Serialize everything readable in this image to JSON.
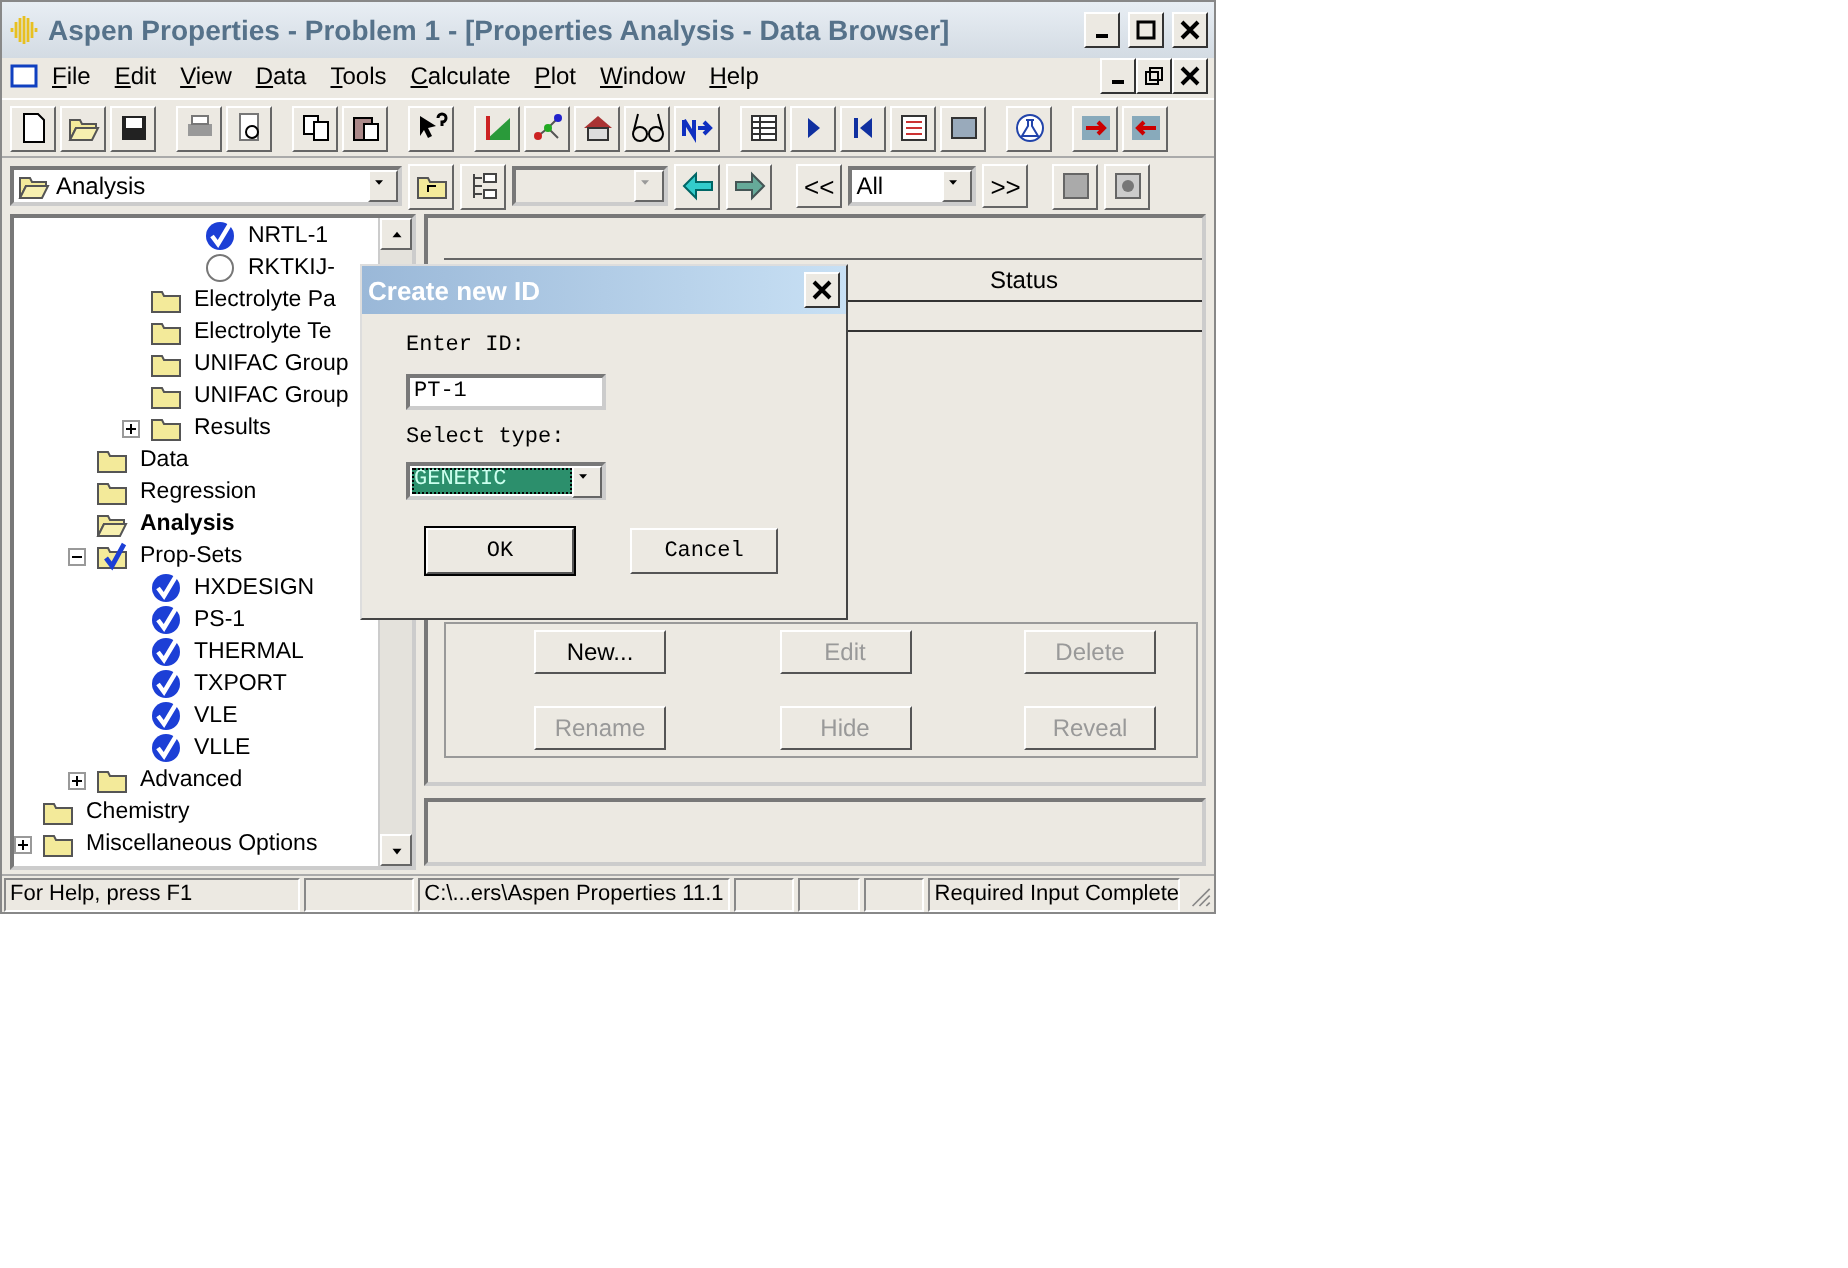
{
  "window": {
    "title": "Aspen Properties - Problem 1 - [Properties Analysis - Data Browser]"
  },
  "menu": [
    "File",
    "Edit",
    "View",
    "Data",
    "Tools",
    "Calculate",
    "Plot",
    "Window",
    "Help"
  ],
  "browser_toolbar": {
    "folder": "Analysis",
    "previous": "<<",
    "filter": "All",
    "next": ">>"
  },
  "tree": [
    {
      "children": [
        {
          "children": [
            {
              "children": [
                {
                  "label": "NRTL-1",
                  "kind": "check"
                },
                {
                  "label": "RKTKIJ-",
                  "kind": "circle"
                }
              ]
            },
            {
              "label": "Electrolyte Pa",
              "kind": "folder"
            },
            {
              "label": "Electrolyte Te",
              "kind": "folder"
            },
            {
              "label": "UNIFAC Group",
              "kind": "folder"
            },
            {
              "label": "UNIFAC Group",
              "kind": "folder"
            },
            {
              "label": "Results",
              "kind": "folder",
              "expanded": false
            }
          ]
        },
        {
          "label": "Data",
          "kind": "folder"
        },
        {
          "label": "Regression",
          "kind": "folder"
        },
        {
          "label": "Analysis",
          "kind": "open",
          "selected": true
        },
        {
          "label": "Prop-Sets",
          "kind": "checkfolder",
          "expanded": true,
          "children": [
            {
              "label": "HXDESIGN",
              "kind": "check"
            },
            {
              "label": "PS-1",
              "kind": "check"
            },
            {
              "label": "THERMAL",
              "kind": "check"
            },
            {
              "label": "TXPORT",
              "kind": "check"
            },
            {
              "label": "VLE",
              "kind": "check"
            },
            {
              "label": "VLLE",
              "kind": "check"
            }
          ]
        },
        {
          "label": "Advanced",
          "kind": "folder",
          "expanded": false
        }
      ]
    },
    {
      "label": "Chemistry",
      "kind": "folder"
    },
    {
      "label": "Miscellaneous Options",
      "kind": "folder",
      "expanded": false
    }
  ],
  "object_panel": {
    "column": "Status",
    "buttons": [
      {
        "label": "New...",
        "disabled": false
      },
      {
        "label": "Edit",
        "disabled": true
      },
      {
        "label": "Delete",
        "disabled": true
      },
      {
        "label": "Rename",
        "disabled": true
      },
      {
        "label": "Hide",
        "disabled": true
      },
      {
        "label": "Reveal",
        "disabled": true
      }
    ]
  },
  "status_bar": {
    "help": "For Help, press F1",
    "path": "C:\\...ers\\Aspen Properties 11.1",
    "status": "Required Input Complete"
  },
  "dialog": {
    "title": "Create new ID",
    "id_label": "Enter ID:",
    "id_value": "PT-1",
    "type_label": "Select type:",
    "type_value": "GENERIC",
    "buttons": [
      {
        "label": "OK",
        "default": true
      },
      {
        "label": "Cancel",
        "default": false
      }
    ]
  }
}
